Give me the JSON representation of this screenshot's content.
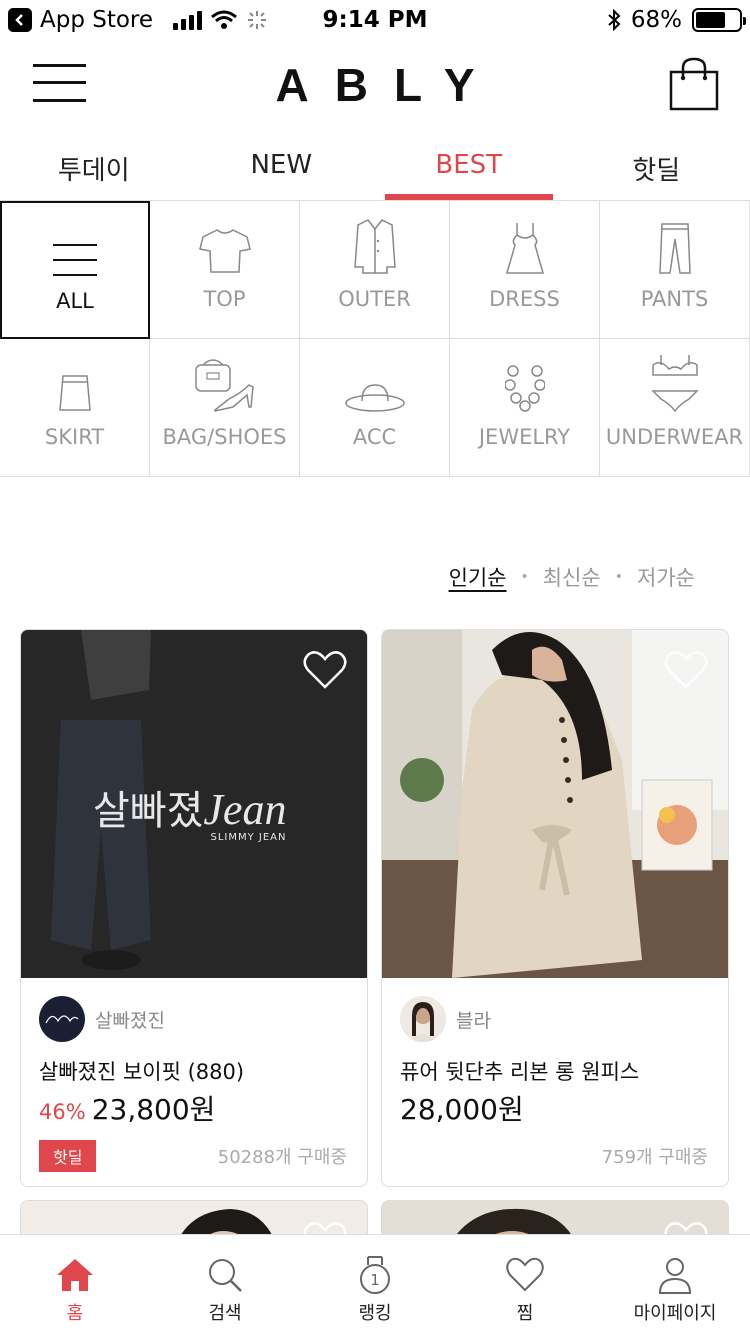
{
  "status_bar": {
    "back_label": "App Store",
    "time": "9:14 PM",
    "battery": "68%",
    "battery_level": 0.68
  },
  "header": {
    "logo": "ABLY"
  },
  "tabs": [
    {
      "label": "투데이"
    },
    {
      "label": "NEW"
    },
    {
      "label": "BEST",
      "active": true
    },
    {
      "label": "핫딜"
    }
  ],
  "categories": [
    {
      "label": "ALL",
      "icon": "list-icon",
      "active": true
    },
    {
      "label": "TOP",
      "icon": "tshirt-icon"
    },
    {
      "label": "OUTER",
      "icon": "coat-icon"
    },
    {
      "label": "DRESS",
      "icon": "dress-icon"
    },
    {
      "label": "PANTS",
      "icon": "pants-icon"
    },
    {
      "label": "SKIRT",
      "icon": "skirt-icon"
    },
    {
      "label": "BAG/SHOES",
      "icon": "bag-shoes-icon"
    },
    {
      "label": "ACC",
      "icon": "hat-icon"
    },
    {
      "label": "JEWELRY",
      "icon": "necklace-icon"
    },
    {
      "label": "UNDERWEAR",
      "icon": "underwear-icon"
    }
  ],
  "sort": {
    "options": [
      "인기순",
      "최신순",
      "저가순"
    ],
    "selected": "인기순"
  },
  "products": [
    {
      "shop": "살빠졌진",
      "name": "살빠졌진 보이핏 (880)",
      "discount": "46%",
      "price": "23,800원",
      "badge": "핫딜",
      "buying": "50288개 구매중",
      "image_overlay_main": "살빠졌",
      "image_overlay_script": "Jean",
      "image_overlay_sub": "SLIMMY JEAN"
    },
    {
      "shop": "블라",
      "name": "퓨어 뒷단추 리본 롱 원피스",
      "discount": "",
      "price": "28,000원",
      "badge": "",
      "buying": "759개 구매중"
    }
  ],
  "bottom_nav": [
    {
      "label": "홈",
      "icon": "home-icon",
      "active": true
    },
    {
      "label": "검색",
      "icon": "search-icon"
    },
    {
      "label": "랭킹",
      "icon": "ranking-medal-icon"
    },
    {
      "label": "찜",
      "icon": "heart-icon"
    },
    {
      "label": "마이페이지",
      "icon": "person-icon"
    }
  ],
  "colors": {
    "accent": "#e0474c",
    "text": "#111111",
    "muted": "#999999",
    "border": "#dddddd"
  }
}
